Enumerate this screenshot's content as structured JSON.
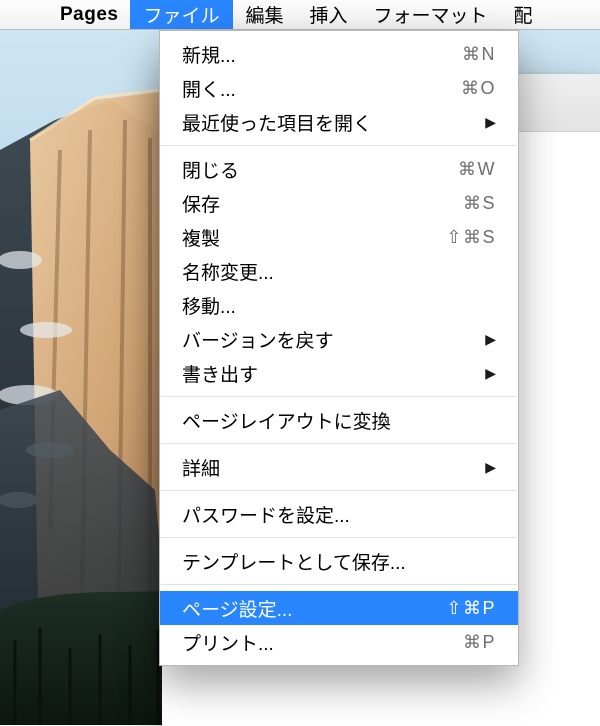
{
  "menubar": {
    "appname": "Pages",
    "items": [
      "ファイル",
      "編集",
      "挿入",
      "フォーマット",
      "配"
    ],
    "activeIndex": 0
  },
  "dropdown": {
    "groups": [
      [
        {
          "label": "新規...",
          "shortcut": "⌘N"
        },
        {
          "label": "開く...",
          "shortcut": "⌘O"
        },
        {
          "label": "最近使った項目を開く",
          "submenu": true
        }
      ],
      [
        {
          "label": "閉じる",
          "shortcut": "⌘W"
        },
        {
          "label": "保存",
          "shortcut": "⌘S"
        },
        {
          "label": "複製",
          "shortcut": "⇧⌘S"
        },
        {
          "label": "名称変更..."
        },
        {
          "label": "移動..."
        },
        {
          "label": "バージョンを戻す",
          "submenu": true
        },
        {
          "label": "書き出す",
          "submenu": true
        }
      ],
      [
        {
          "label": "ページレイアウトに変換"
        }
      ],
      [
        {
          "label": "詳細",
          "submenu": true
        }
      ],
      [
        {
          "label": "パスワードを設定..."
        }
      ],
      [
        {
          "label": "テンプレートとして保存..."
        }
      ],
      [
        {
          "label": "ページ設定...",
          "shortcut": "⇧⌘P",
          "highlight": true
        },
        {
          "label": "プリント...",
          "shortcut": "⌘P"
        }
      ]
    ]
  }
}
